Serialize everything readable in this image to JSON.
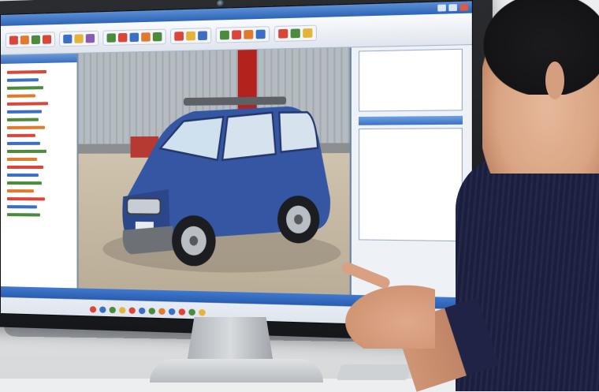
{
  "photo": {
    "subject": "person-pointing-at-monitor",
    "colors": {
      "shirt": "#23284a",
      "car_body": "#3556a3",
      "app_titlebar": "#2e64b6"
    }
  },
  "monitor_screen": {
    "app": {
      "toolbar": {
        "icon_groups": [
          [
            "tool-icon",
            "tool-icon",
            "tool-icon",
            "tool-icon"
          ],
          [
            "tool-icon",
            "tool-icon",
            "tool-icon"
          ],
          [
            "tool-icon",
            "tool-icon",
            "tool-icon",
            "tool-icon",
            "tool-icon"
          ],
          [
            "tool-icon",
            "tool-icon",
            "tool-icon"
          ],
          [
            "tool-icon",
            "tool-icon",
            "tool-icon",
            "tool-icon"
          ],
          [
            "tool-icon",
            "tool-icon",
            "tool-icon"
          ]
        ]
      },
      "viewport": {
        "scene": "garage",
        "model": "blue-suv-3d-model"
      },
      "status_icons": [
        "status-icon",
        "status-icon",
        "status-icon",
        "status-icon",
        "status-icon",
        "status-icon",
        "status-icon",
        "status-icon",
        "status-icon",
        "status-icon",
        "status-icon",
        "status-icon"
      ]
    }
  }
}
